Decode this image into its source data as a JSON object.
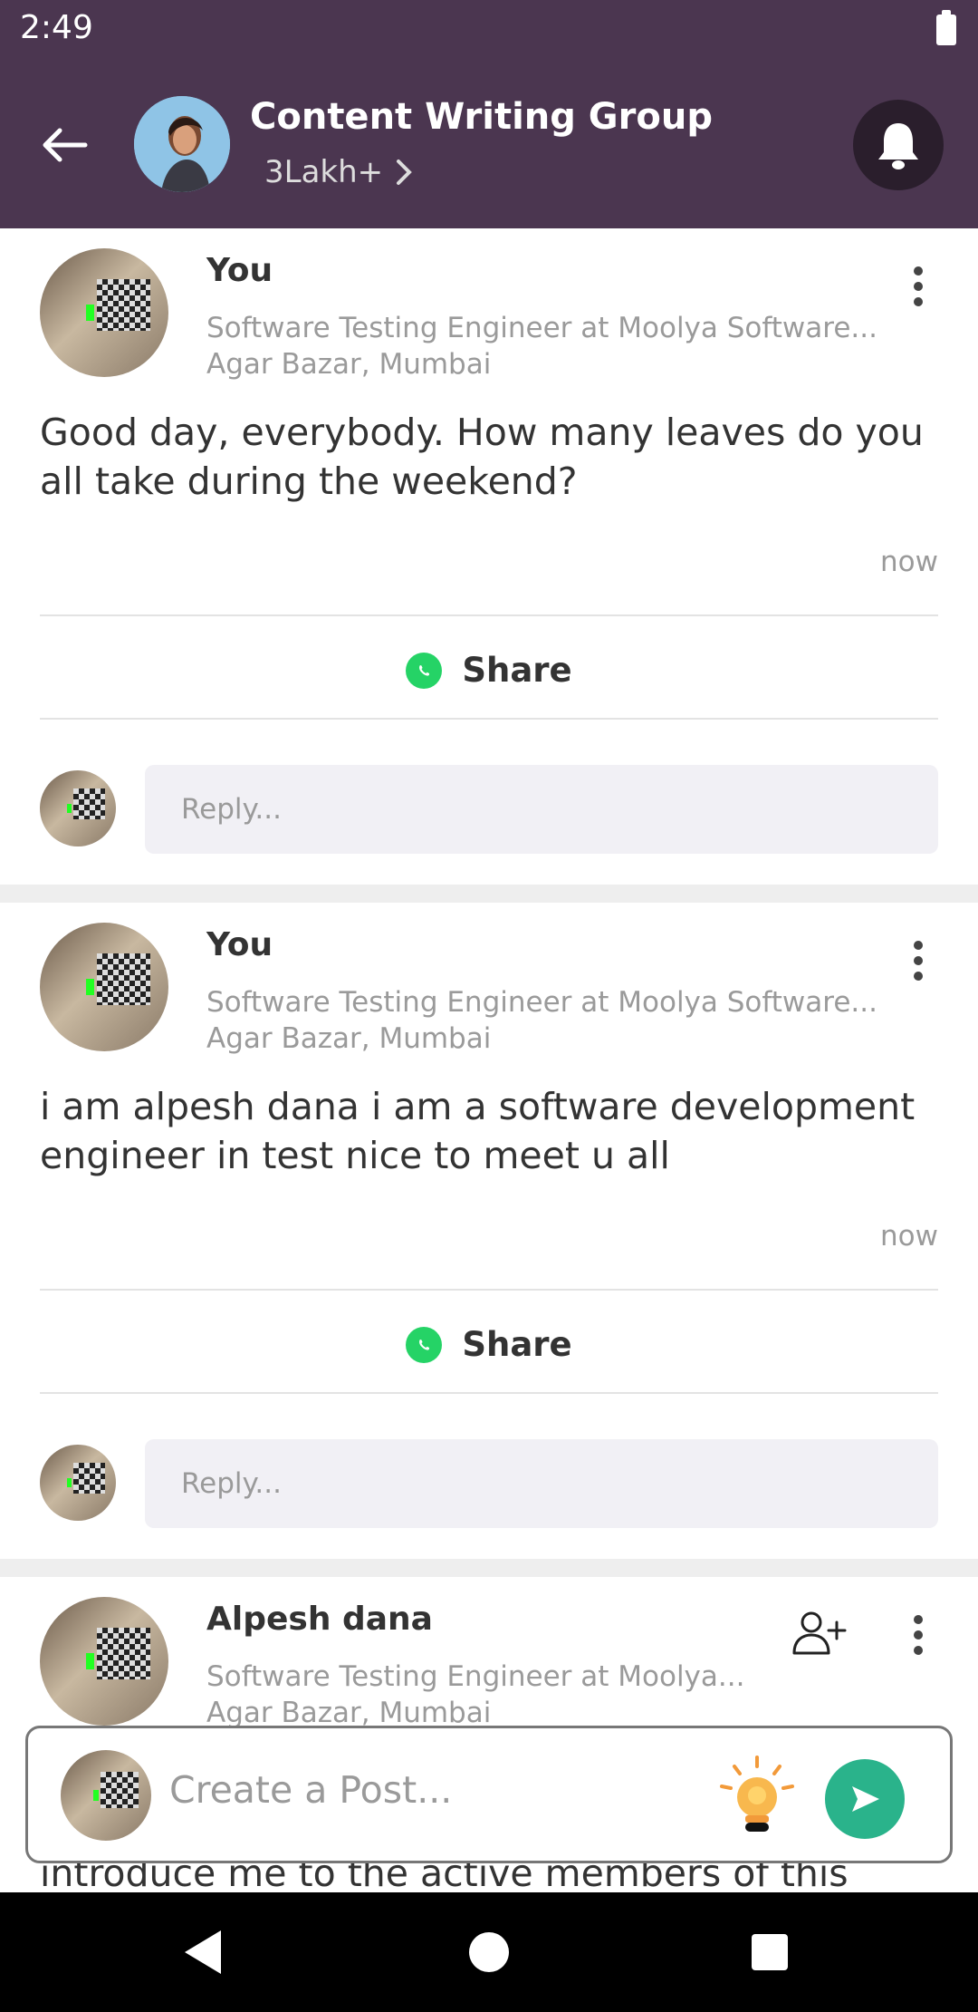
{
  "status_bar": {
    "time": "2:49"
  },
  "header": {
    "title": "Content Writing Group",
    "members": "3Lakh+"
  },
  "posts": [
    {
      "author": "You",
      "headline": "Software Testing Engineer at Moolya Software...",
      "location": "Agar Bazar, Mumbai",
      "text": "Good day, everybody. How many leaves do you all take during the weekend?",
      "time": "now",
      "share_label": "Share",
      "reply_placeholder": "Reply..."
    },
    {
      "author": "You",
      "headline": "Software Testing Engineer at Moolya Software...",
      "location": "Agar Bazar, Mumbai",
      "text": "i am alpesh dana i am a software development engineer in test nice to meet u all",
      "time": "now",
      "share_label": "Share",
      "reply_placeholder": "Reply..."
    },
    {
      "author": "Alpesh dana",
      "headline": "Software Testing Engineer at Moolya...",
      "location": "Agar Bazar, Mumbai",
      "text": "introduce me to the active members of this"
    }
  ],
  "composer": {
    "placeholder": "Create a Post..."
  },
  "colors": {
    "header_bg": "#4b3650",
    "send_button": "#2ab38b",
    "whatsapp": "#25d366"
  }
}
